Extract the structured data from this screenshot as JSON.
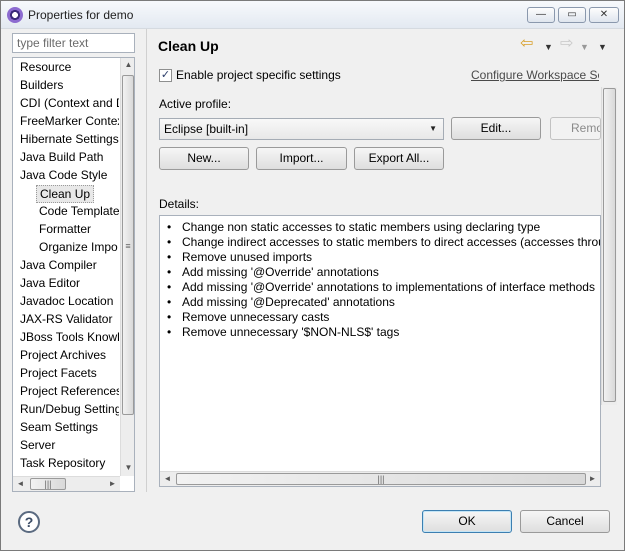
{
  "window": {
    "title": "Properties for demo",
    "buttons": {
      "minimize": "—",
      "maximize": "▭",
      "close": "✕"
    }
  },
  "filter": {
    "placeholder": "type filter text"
  },
  "tree": {
    "items": [
      {
        "label": "Resource",
        "level": 0
      },
      {
        "label": "Builders",
        "level": 0
      },
      {
        "label": "CDI (Context and D",
        "level": 0
      },
      {
        "label": "FreeMarker Contex",
        "level": 0
      },
      {
        "label": "Hibernate Settings",
        "level": 0
      },
      {
        "label": "Java Build Path",
        "level": 0
      },
      {
        "label": "Java Code Style",
        "level": 0
      },
      {
        "label": "Clean Up",
        "level": 1,
        "selected": true
      },
      {
        "label": "Code Template",
        "level": 1
      },
      {
        "label": "Formatter",
        "level": 1
      },
      {
        "label": "Organize Impo",
        "level": 1
      },
      {
        "label": "Java Compiler",
        "level": 0
      },
      {
        "label": "Java Editor",
        "level": 0
      },
      {
        "label": "Javadoc Location",
        "level": 0
      },
      {
        "label": "JAX-RS Validator",
        "level": 0
      },
      {
        "label": "JBoss Tools Knowle",
        "level": 0
      },
      {
        "label": "Project Archives",
        "level": 0
      },
      {
        "label": "Project Facets",
        "level": 0
      },
      {
        "label": "Project References",
        "level": 0
      },
      {
        "label": "Run/Debug Setting",
        "level": 0
      },
      {
        "label": "Seam Settings",
        "level": 0
      },
      {
        "label": "Server",
        "level": 0
      },
      {
        "label": "Task Repository",
        "level": 0
      }
    ],
    "scroll": {
      "up": "▲",
      "down": "▼",
      "left": "◄",
      "right": "►",
      "grip": "|||"
    }
  },
  "page": {
    "title": "Clean Up",
    "nav": {
      "back_icon": "back-arrow-icon",
      "forward_icon": "forward-arrow-icon",
      "dropdown": "▼"
    },
    "enable_label": "Enable project specific settings",
    "enable_checked": true,
    "configure_link": "Configure Workspace Se",
    "active_profile_label": "Active profile:",
    "profile_value": "Eclipse [built-in]",
    "buttons": {
      "edit": "Edit...",
      "remove": "Remo",
      "new": "New...",
      "import": "Import...",
      "export": "Export All..."
    },
    "details_label": "Details:",
    "details": [
      "Change non static accesses to static members using declaring type",
      "Change indirect accesses to static members to direct accesses (accesses through",
      "Remove unused imports",
      "Add missing '@Override' annotations",
      "Add missing '@Override' annotations to implementations of interface methods",
      "Add missing '@Deprecated' annotations",
      "Remove unnecessary casts",
      "Remove unnecessary '$NON-NLS$' tags"
    ]
  },
  "footer": {
    "help": "?",
    "ok": "OK",
    "cancel": "Cancel"
  }
}
